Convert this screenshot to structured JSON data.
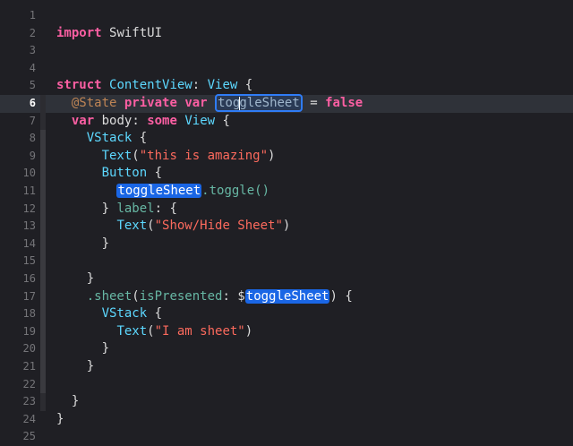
{
  "editor": {
    "lines": [
      {
        "n": "1"
      },
      {
        "n": "2"
      },
      {
        "n": "3"
      },
      {
        "n": "4"
      },
      {
        "n": "5"
      },
      {
        "n": "6"
      },
      {
        "n": "7"
      },
      {
        "n": "8"
      },
      {
        "n": "9"
      },
      {
        "n": "10"
      },
      {
        "n": "11"
      },
      {
        "n": "12"
      },
      {
        "n": "13"
      },
      {
        "n": "14"
      },
      {
        "n": "15"
      },
      {
        "n": "16"
      },
      {
        "n": "17"
      },
      {
        "n": "18"
      },
      {
        "n": "19"
      },
      {
        "n": "20"
      },
      {
        "n": "21"
      },
      {
        "n": "22"
      },
      {
        "n": "23"
      },
      {
        "n": "24"
      },
      {
        "n": "25"
      }
    ],
    "t": {
      "import": "import",
      "swiftui": "SwiftUI",
      "struct": "struct",
      "contentview": "ContentView",
      "colon": ":",
      "view": "View",
      "open_brace": " {",
      "state": "@State",
      "private": "private",
      "var": "var",
      "toggle_a": "tog",
      "toggle_b": "gleSheet",
      "toggleSheet": "toggleSheet",
      "eq": " = ",
      "false": "false",
      "body": "body",
      "some": "some",
      "vstack": "VStack",
      "text": "Text",
      "paren_open": "(",
      "paren_close": ")",
      "s_amazing": "\"this is amazing\"",
      "button": "Button",
      "dot_toggle": ".toggle()",
      "close_brace": "}",
      "label": "label",
      "s_showhide": "\"Show/Hide Sheet\"",
      "sheet": ".sheet",
      "ispresented": "isPresented",
      "dollar": "$",
      "s_sheet": "\"I am sheet\""
    }
  },
  "colors": {
    "background": "#1f1f24",
    "current_line": "#2f3239",
    "keyword": "#fc5fa3",
    "type": "#5dd8ff",
    "function": "#67b7a4",
    "string": "#fc6a5d",
    "attribute": "#bf8555",
    "highlight": "#1a66e5",
    "fold_ribbon": "#3a3a3f"
  }
}
